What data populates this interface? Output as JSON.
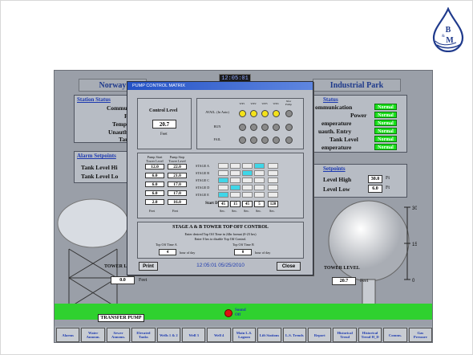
{
  "logo": {
    "letters_top": "B",
    "amp": "&",
    "letters_bottom": "M"
  },
  "header": {
    "left_site": "Norway",
    "right_site": "Industrial Park",
    "clock": "12:05:01"
  },
  "left_status": {
    "title": "Station Status",
    "rows": [
      "Communicat",
      "Pov",
      "Temperat",
      "Unauth. En",
      "Tank Le"
    ]
  },
  "right_status": {
    "title": "Status",
    "rows": [
      {
        "label": "ommunication",
        "value": "Normal"
      },
      {
        "label": "Power",
        "value": "Normal"
      },
      {
        "label": "emperature",
        "value": "Normal"
      },
      {
        "label": "uauth. Entry",
        "value": "Normal"
      },
      {
        "label": "Tank Level",
        "value": "Normal"
      },
      {
        "label": "emperature",
        "value": "Normal"
      }
    ]
  },
  "left_alarm": {
    "title": "Alarm Setpoints",
    "rows": [
      "Tank Level Hi",
      "Tank Level Lo"
    ]
  },
  "right_alarm": {
    "title": "Setpoints",
    "rows": [
      {
        "label": "Level High",
        "value": "30.0",
        "unit": "Ft"
      },
      {
        "label": "Level Low",
        "value": "6.0",
        "unit": "Ft"
      }
    ]
  },
  "left_tower": {
    "label": "TOWER LE",
    "value": "0.0",
    "unit": "Feet"
  },
  "right_tower": {
    "label": "TOWER LEVEL",
    "value": "20.7",
    "unit": "Feet",
    "scale_top": "30",
    "scale_mid": "15",
    "scale_bottom": "0"
  },
  "transfer_pump": "TRANSFER PUMP",
  "sound": {
    "line1": "Sound",
    "line2": "Off"
  },
  "nav": [
    "Alarms",
    "Water Announ.",
    "Sewer Announ.",
    "Elevated Tanks",
    "Wells 1 & 2",
    "Well 3",
    "Well 4",
    "Main L.S. Lagoon",
    "Lift Stations",
    "L.S. Trends",
    "Report",
    "Historical Trend",
    "Historical Trend H_D",
    "Comms.",
    "Gas Pressure"
  ],
  "dialog": {
    "title": "PUMP CONTROL MATRIX",
    "control_level_label": "Control Level",
    "control_level_value": "20.7",
    "control_level_unit": "Feet",
    "well_headers": [
      "WP1",
      "WP2",
      "WP3",
      "WP4",
      "Xfer Pump"
    ],
    "status_rows": [
      "AVAIL. (In Auto)",
      "RUN",
      "FAIL"
    ],
    "avail_colors": [
      "#f4e21a",
      "#f4e21a",
      "#f4e21a",
      "#f4e21a",
      "#8a8a8a"
    ],
    "start_header": "Pump Start Tower Level",
    "stop_header": "Pump Stop Tower Level",
    "levels": [
      {
        "start": "12.0",
        "stop": "22.0"
      },
      {
        "start": "6.0",
        "stop": "21.0"
      },
      {
        "start": "6.0",
        "stop": "17.0"
      },
      {
        "start": "6.0",
        "stop": "17.0"
      },
      {
        "start": "2.0",
        "stop": "16.0"
      }
    ],
    "feet": "Feet",
    "stages": [
      "STAGE A",
      "STAGE B",
      "STAGE C",
      "STAGE D",
      "STAGE E"
    ],
    "matrix_on": [
      [
        false,
        false,
        false,
        true,
        false
      ],
      [
        false,
        false,
        true,
        false,
        false
      ],
      [
        true,
        false,
        false,
        false,
        false
      ],
      [
        false,
        true,
        false,
        false,
        false
      ],
      [
        true,
        false,
        false,
        false,
        false
      ]
    ],
    "start_delay_label": "Start Delay",
    "delays": [
      "45",
      "15",
      "45",
      "5",
      "120"
    ],
    "sec": "Sec.",
    "topoff_title": "STAGE A & B TOWER TOP OFF CONTROL",
    "topoff_text1": "Enter desired Top Off Time in 24hr format (0-23 hrs)",
    "topoff_text2": "Enter 0 hrs to disable Top Off Control.",
    "time_a_label": "Top Off Time A",
    "time_a_value": "4",
    "time_b_label": "Top Off Time B",
    "time_b_value": "0",
    "hour_label": "hour of day",
    "print_label": "Print",
    "timestamp": "12:05:01 05/25/2010",
    "close_label": "Close"
  }
}
